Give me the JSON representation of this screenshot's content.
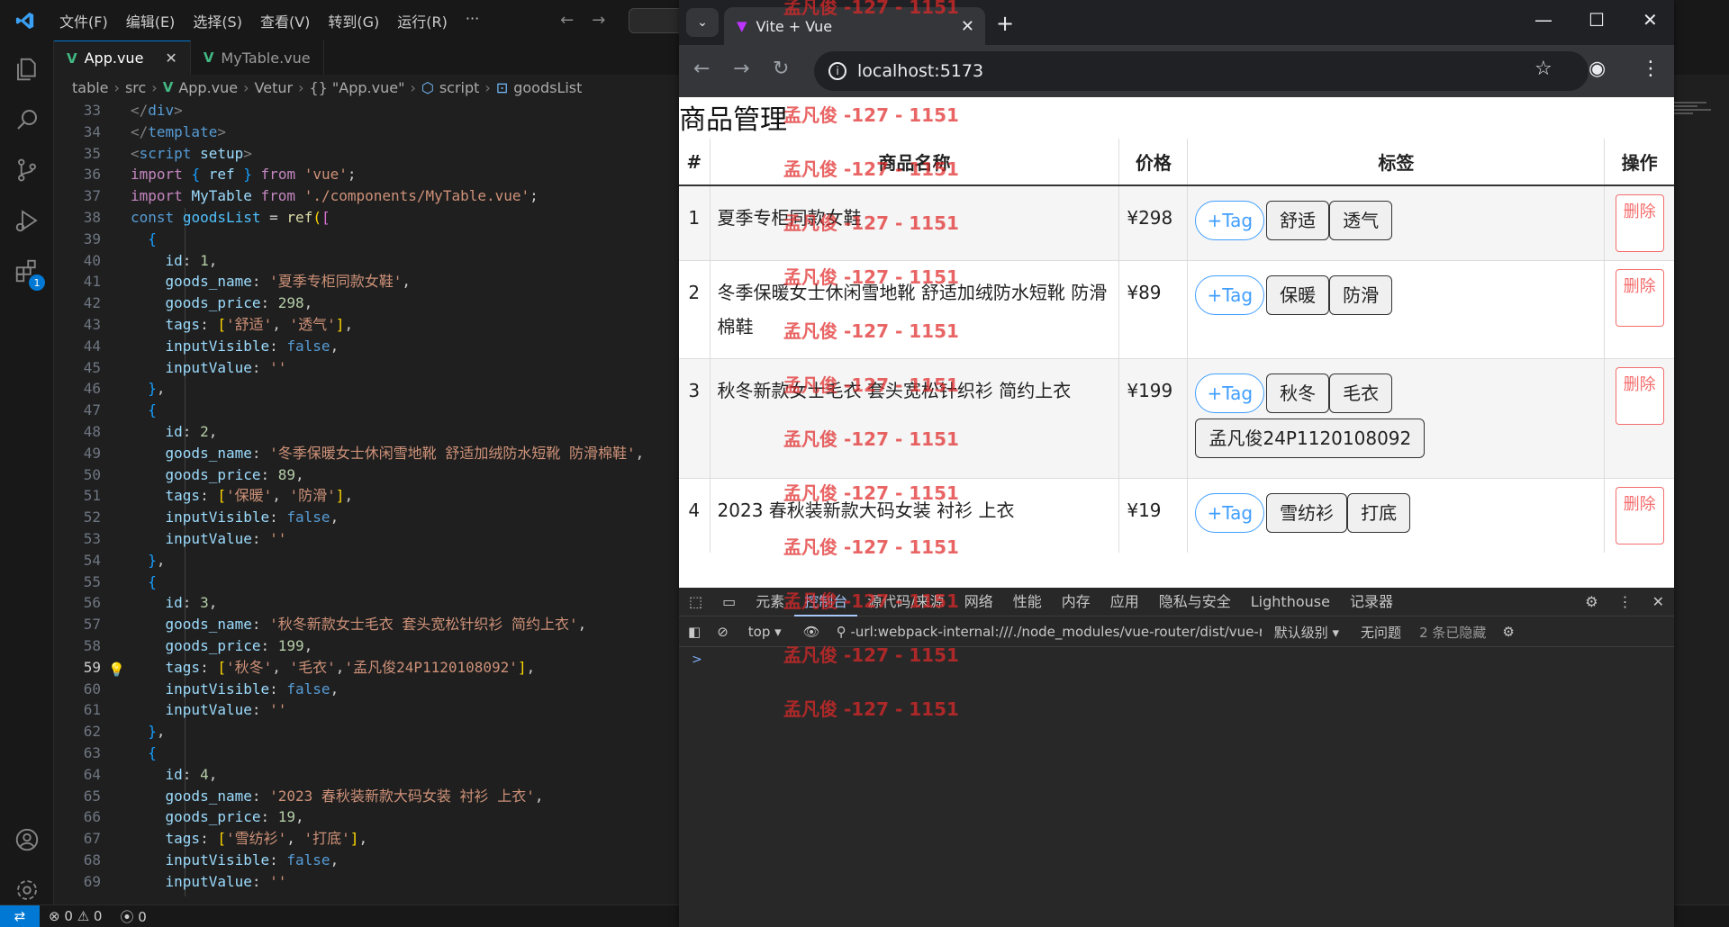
{
  "vscode": {
    "menu": [
      "文件(F)",
      "编辑(E)",
      "选择(S)",
      "查看(V)",
      "转到(G)",
      "运行(R)",
      "···"
    ],
    "tabs": [
      {
        "label": "App.vue",
        "active": true
      },
      {
        "label": "MyTable.vue",
        "active": false
      }
    ],
    "breadcrumb": [
      "table",
      "src",
      "App.vue",
      "Vetur",
      "{} \"App.vue\"",
      "script",
      "goodsList"
    ],
    "status": {
      "errors": "0",
      "warnings": "0",
      "ports": "0"
    },
    "code_lines": [
      {
        "n": "33",
        "html": "<span class=\"tag\">&lt;/</span><span class=\"tagname\">div</span><span class=\"tag\">&gt;</span>"
      },
      {
        "n": "34",
        "html": "<span class=\"tag\">&lt;/</span><span class=\"tagname\">template</span><span class=\"tag\">&gt;</span>"
      },
      {
        "n": "35",
        "html": "<span class=\"tag\">&lt;</span><span class=\"tagname\">script</span> <span class=\"prop\">setup</span><span class=\"tag\">&gt;</span>"
      },
      {
        "n": "36",
        "html": "<span class=\"kw2\">import</span> <span class=\"brk3\">{</span> <span class=\"prop\">ref</span> <span class=\"brk3\">}</span> <span class=\"kw2\">from</span> <span class=\"str\">'vue'</span>;"
      },
      {
        "n": "37",
        "html": "<span class=\"kw2\">import</span> <span class=\"prop\">MyTable</span> <span class=\"kw2\">from</span> <span class=\"str\">'./components/MyTable.vue'</span>;"
      },
      {
        "n": "38",
        "html": "<span class=\"kw\">const</span> <span class=\"var\">goodsList</span> = <span class=\"fn\">ref</span><span class=\"brk\">(</span><span class=\"brk2\">[</span>"
      },
      {
        "n": "39",
        "html": "  <span class=\"brk3\">{</span>"
      },
      {
        "n": "40",
        "html": "    <span class=\"prop\">id</span>: <span class=\"num\">1</span>,"
      },
      {
        "n": "41",
        "html": "    <span class=\"prop\">goods_name</span>: <span class=\"str\">'夏季专柜同款女鞋'</span>,"
      },
      {
        "n": "42",
        "html": "    <span class=\"prop\">goods_price</span>: <span class=\"num\">298</span>,"
      },
      {
        "n": "43",
        "html": "    <span class=\"prop\">tags</span>: <span class=\"brk\">[</span><span class=\"str\">'舒适'</span>, <span class=\"str\">'透气'</span><span class=\"brk\">]</span>,"
      },
      {
        "n": "44",
        "html": "    <span class=\"prop\">inputVisible</span>: <span class=\"kw\">false</span>,"
      },
      {
        "n": "45",
        "html": "    <span class=\"prop\">inputValue</span>: <span class=\"str\">''</span>"
      },
      {
        "n": "46",
        "html": "  <span class=\"brk3\">}</span>,"
      },
      {
        "n": "47",
        "html": "  <span class=\"brk3\">{</span>"
      },
      {
        "n": "48",
        "html": "    <span class=\"prop\">id</span>: <span class=\"num\">2</span>,"
      },
      {
        "n": "49",
        "html": "    <span class=\"prop\">goods_name</span>: <span class=\"str\">'冬季保暖女士休闲雪地靴 舒适加绒防水短靴 防滑棉鞋'</span>,"
      },
      {
        "n": "50",
        "html": "    <span class=\"prop\">goods_price</span>: <span class=\"num\">89</span>,"
      },
      {
        "n": "51",
        "html": "    <span class=\"prop\">tags</span>: <span class=\"brk\">[</span><span class=\"str\">'保暖'</span>, <span class=\"str\">'防滑'</span><span class=\"brk\">]</span>,"
      },
      {
        "n": "52",
        "html": "    <span class=\"prop\">inputVisible</span>: <span class=\"kw\">false</span>,"
      },
      {
        "n": "53",
        "html": "    <span class=\"prop\">inputValue</span>: <span class=\"str\">''</span>"
      },
      {
        "n": "54",
        "html": "  <span class=\"brk3\">}</span>,"
      },
      {
        "n": "55",
        "html": "  <span class=\"brk3\">{</span>"
      },
      {
        "n": "56",
        "html": "    <span class=\"prop\">id</span>: <span class=\"num\">3</span>,"
      },
      {
        "n": "57",
        "html": "    <span class=\"prop\">goods_name</span>: <span class=\"str\">'秋冬新款女士毛衣 套头宽松针织衫 简约上衣'</span>,"
      },
      {
        "n": "58",
        "html": "    <span class=\"prop\">goods_price</span>: <span class=\"num\">199</span>,"
      },
      {
        "n": "59",
        "html": "    <span class=\"prop\">tags</span>: <span class=\"brk\">[</span><span class=\"str\">'秋冬'</span>, <span class=\"str\">'毛衣'</span>,<span class=\"str\">'孟凡俊24P1120108092'</span><span class=\"brk\">]</span>,",
        "current": true
      },
      {
        "n": "60",
        "html": "    <span class=\"prop\">inputVisible</span>: <span class=\"kw\">false</span>,"
      },
      {
        "n": "61",
        "html": "    <span class=\"prop\">inputValue</span>: <span class=\"str\">''</span>"
      },
      {
        "n": "62",
        "html": "  <span class=\"brk3\">}</span>,"
      },
      {
        "n": "63",
        "html": "  <span class=\"brk3\">{</span>"
      },
      {
        "n": "64",
        "html": "    <span class=\"prop\">id</span>: <span class=\"num\">4</span>,"
      },
      {
        "n": "65",
        "html": "    <span class=\"prop\">goods_name</span>: <span class=\"str\">'2023 春秋装新款大码女装 衬衫 上衣'</span>,"
      },
      {
        "n": "66",
        "html": "    <span class=\"prop\">goods_price</span>: <span class=\"num\">19</span>,"
      },
      {
        "n": "67",
        "html": "    <span class=\"prop\">tags</span>: <span class=\"brk\">[</span><span class=\"str\">'雪纺衫'</span>, <span class=\"str\">'打底'</span><span class=\"brk\">]</span>,"
      },
      {
        "n": "68",
        "html": "    <span class=\"prop\">inputVisible</span>: <span class=\"kw\">false</span>,"
      },
      {
        "n": "69",
        "html": "    <span class=\"prop\">inputValue</span>: <span class=\"str\">''</span>"
      }
    ]
  },
  "browser": {
    "tab_title": "Vite + Vue",
    "url": "localhost:5173",
    "page": {
      "title": "商品管理",
      "columns": [
        "#",
        "商品名称",
        "价格",
        "标签",
        "操作"
      ],
      "add_tag_label": "+Tag",
      "delete_label": "删除",
      "rows": [
        {
          "id": "1",
          "name": "夏季专柜同款女鞋",
          "price": "¥298",
          "tags": [
            "舒适",
            "透气"
          ]
        },
        {
          "id": "2",
          "name": "冬季保暖女士休闲雪地靴 舒适加绒防水短靴 防滑棉鞋",
          "price": "¥89",
          "tags": [
            "保暖",
            "防滑"
          ]
        },
        {
          "id": "3",
          "name": "秋冬新款女士毛衣 套头宽松针织衫 简约上衣",
          "price": "¥199",
          "tags": [
            "秋冬",
            "毛衣",
            "孟凡俊24P1120108092"
          ]
        },
        {
          "id": "4",
          "name": "2023 春秋装新款大码女装 衬衫 上衣",
          "price": "¥19",
          "tags": [
            "雪纺衫",
            "打底"
          ]
        }
      ]
    },
    "devtools": {
      "tabs": [
        "元素",
        "控制台",
        "源代码/来源",
        "网络",
        "性能",
        "内存",
        "应用",
        "隐私与安全",
        "Lighthouse",
        "记录器"
      ],
      "active_tab": "控制台",
      "context": "top",
      "filter": "-url:webpack-internal:///./node_modules/vue-router/dist/vue-router.esm",
      "level": "默认级别",
      "issues": "无问题",
      "hidden": "2 条已隐藏",
      "prompt": ">"
    }
  },
  "watermark": "孟凡俊 -127 - 1151",
  "colors": {
    "accent": "#409eff",
    "danger": "#f56c6c",
    "vscode_accent": "#0078d4"
  }
}
